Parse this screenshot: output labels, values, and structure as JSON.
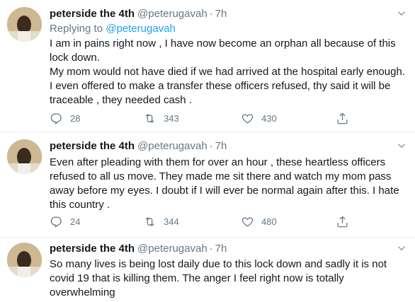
{
  "tweets": [
    {
      "name": "peterside the 4th",
      "handle": "@peterugavah",
      "separator": "·",
      "time": "7h",
      "reply_prefix": "Replying to",
      "reply_to": "@peterugavah",
      "lines": [
        "I am in pains right now , I have now become an orphan all because of this lock down.",
        "My mom would not have died if we had arrived at  the hospital early enough. I even offered to make a transfer these officers refused, thy said it will be traceable , they needed cash ."
      ],
      "replies": "28",
      "retweets": "343",
      "likes": "430"
    },
    {
      "name": "peterside the 4th",
      "handle": "@peterugavah",
      "separator": "·",
      "time": "7h",
      "lines": [
        "Even after pleading with them for over an hour , these heartless officers refused to all us move. They made me sit there and watch my mom pass away before my eyes. I doubt if I will ever be normal again after this.  I hate this country ."
      ],
      "replies": "24",
      "retweets": "344",
      "likes": "480"
    },
    {
      "name": "peterside the 4th",
      "handle": "@peterugavah",
      "separator": "·",
      "time": "7h",
      "lines": [
        "So many lives is being lost daily due to this lock down and sadly it is not covid 19 that is killing them. The anger I feel right now is totally overwhelming"
      ]
    }
  ],
  "icons": {
    "reply": "reply-icon",
    "retweet": "retweet-icon",
    "like": "heart-icon",
    "share": "share-icon",
    "more": "chevron-down-icon"
  },
  "colors": {
    "link": "#1da1f2",
    "secondary_text": "#657786",
    "divider": "#e6ecf0"
  }
}
